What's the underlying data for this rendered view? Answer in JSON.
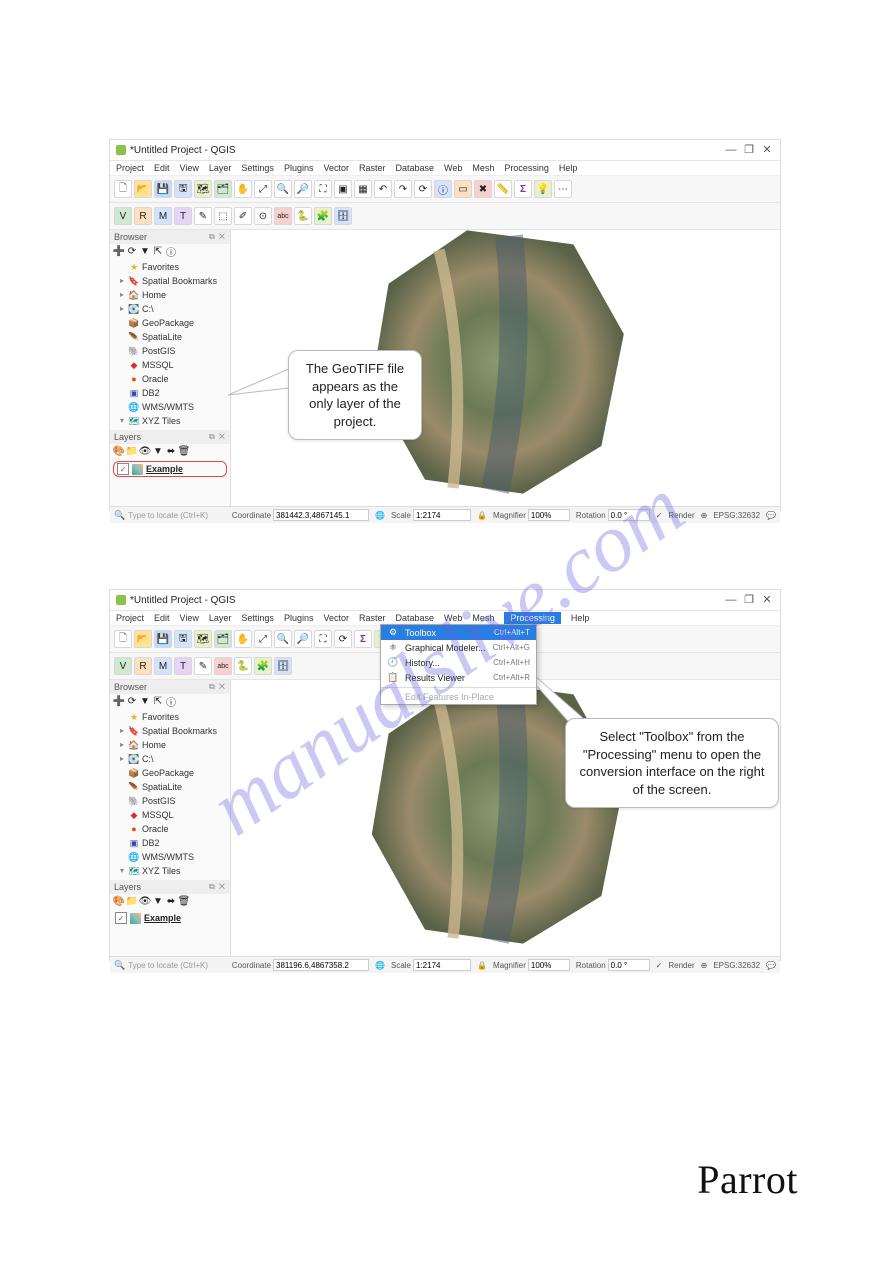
{
  "watermark": "manualslive.com",
  "footer_logo": "Parrot",
  "app": {
    "title": "*Untitled Project - QGIS",
    "win_min": "—",
    "win_max": "❐",
    "win_close": "✕",
    "menus": [
      "Project",
      "Edit",
      "View",
      "Layer",
      "Settings",
      "Plugins",
      "Vector",
      "Raster",
      "Database",
      "Web",
      "Mesh",
      "Processing",
      "Help"
    ]
  },
  "panels": {
    "browser_title": "Browser",
    "layers_title": "Layers",
    "panel_ctl": "⧉ ✕"
  },
  "browser_nodes": [
    {
      "exp": "",
      "icon": "star",
      "label": "Favorites"
    },
    {
      "exp": "▸",
      "icon": "bookmark",
      "label": "Spatial Bookmarks"
    },
    {
      "exp": "▸",
      "icon": "home",
      "label": "Home"
    },
    {
      "exp": "▸",
      "icon": "drive",
      "label": "C:\\"
    },
    {
      "exp": "",
      "icon": "gpkg",
      "label": "GeoPackage"
    },
    {
      "exp": "",
      "icon": "feather",
      "label": "SpatiaLite"
    },
    {
      "exp": "",
      "icon": "pg",
      "label": "PostGIS"
    },
    {
      "exp": "",
      "icon": "mssql",
      "label": "MSSQL"
    },
    {
      "exp": "",
      "icon": "oracle",
      "label": "Oracle"
    },
    {
      "exp": "",
      "icon": "db2",
      "label": "DB2"
    },
    {
      "exp": "",
      "icon": "wms",
      "label": "WMS/WMTS"
    },
    {
      "exp": "▾",
      "icon": "xyz",
      "label": "XYZ Tiles"
    }
  ],
  "layer": {
    "check": "✓",
    "name": "Example"
  },
  "status": {
    "search_placeholder": "Type to locate (Ctrl+K)",
    "coord_label": "Coordinate",
    "coord1": "381442.3,4867145.1",
    "coord2": "381196.6,4867358.2",
    "scale_label": "Scale",
    "scale_value": "1:2174",
    "lock": "🔒",
    "magnifier_label": "Magnifier",
    "magnifier_value": "100%",
    "rotation_label": "Rotation",
    "rotation_value": "0.0 °",
    "render_check": "✓",
    "render_label": "Render",
    "crs_icon": "⊕",
    "crs_value": "EPSG:32632",
    "msg_icon": "💬"
  },
  "callout1": "The GeoTIFF file appears as the only layer of the project.",
  "callout2": "Select \"Toolbox\" from the \"Processing\" menu to open the conversion interface on the right of the screen.",
  "processing_menu": {
    "items": [
      {
        "icon": "⚙",
        "label": "Toolbox",
        "shortcut": "Ctrl+Alt+T",
        "sel": true
      },
      {
        "icon": "⚛",
        "label": "Graphical Modeler...",
        "shortcut": "Ctrl+Alt+G"
      },
      {
        "icon": "🕘",
        "label": "History...",
        "shortcut": "Ctrl+Alt+H"
      },
      {
        "icon": "📋",
        "label": "Results Viewer",
        "shortcut": "Ctrl+Alt+R"
      }
    ],
    "disabled": "Edit Features In-Place"
  }
}
